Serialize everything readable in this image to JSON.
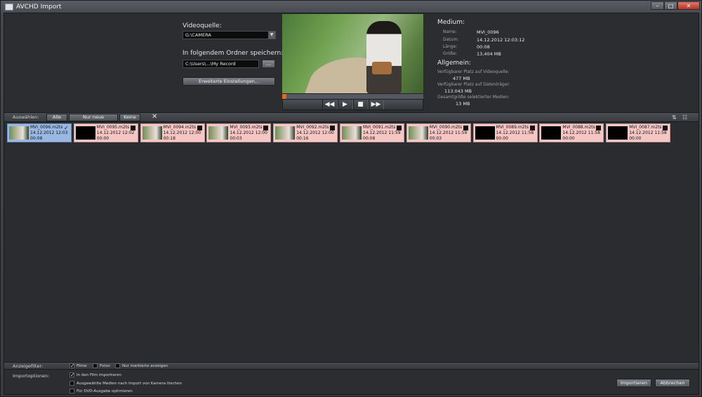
{
  "window": {
    "title": "AVCHD Import",
    "controls": {
      "minimize": "–",
      "maximize": "□",
      "close": "✕"
    }
  },
  "source": {
    "label": "Videoquelle:",
    "value": "G:\\CAMERA",
    "save_label": "In folgendem Ordner speichern:",
    "save_path": "C:\\Users\\...\\My Record",
    "folder_button": "…",
    "advanced_button": "Erweiterte Einstellungen..."
  },
  "player": {
    "progress_percent": 3,
    "buttons": {
      "rewind": "◀◀",
      "play": "▶",
      "stop": "■",
      "forward": "▶▶"
    }
  },
  "medium": {
    "title": "Medium:",
    "fields": [
      {
        "key": "Name:",
        "value": "MVI_0096"
      },
      {
        "key": "Datum:",
        "value": "14.12.2012 12:03:12"
      },
      {
        "key": "Länge:",
        "value": "00:08"
      },
      {
        "key": "Größe:",
        "value": "13,404 MB"
      }
    ]
  },
  "general": {
    "title": "Allgemein:",
    "items": [
      {
        "key": "Verfügbarer Platz auf Videoquelle:",
        "value": "477 MB"
      },
      {
        "key": "Verfügbarer Platz auf Datenträger:",
        "value": "113.043 MB"
      },
      {
        "key": "Gesamtgröße selektierter Medien:",
        "value": "13 MB"
      }
    ]
  },
  "selectbar": {
    "label": "Auswählen:",
    "all": "Alle",
    "new_only": "Nur neue",
    "none": "Keine",
    "clear": "✕",
    "sort_icon": "⇅",
    "view_icon": "☷"
  },
  "media": [
    {
      "name": "MVI_0096.m2ts",
      "date": "14.12.2012 12:03",
      "duration": "00:08",
      "selected": true,
      "thumb": "image"
    },
    {
      "name": "MVI_0095.m2ts",
      "date": "14.12.2012 12:02",
      "duration": "00:00",
      "selected": false,
      "thumb": "black"
    },
    {
      "name": "MVI_0094.m2ts",
      "date": "14.12.2012 12:00",
      "duration": "00:18",
      "selected": false,
      "thumb": "image"
    },
    {
      "name": "MVI_0093.m2ts",
      "date": "14.12.2012 12:00",
      "duration": "00:03",
      "selected": false,
      "thumb": "image"
    },
    {
      "name": "MVI_0092.m2ts",
      "date": "14.12.2012 12:00",
      "duration": "00:16",
      "selected": false,
      "thumb": "image"
    },
    {
      "name": "MVI_0091.m2ts",
      "date": "14.12.2012 11:59",
      "duration": "00:08",
      "selected": false,
      "thumb": "image"
    },
    {
      "name": "MVI_0090.m2ts",
      "date": "14.12.2012 11:59",
      "duration": "00:03",
      "selected": false,
      "thumb": "image"
    },
    {
      "name": "MVI_0089.m2ts",
      "date": "14.12.2012 11:58",
      "duration": "00:00",
      "selected": false,
      "thumb": "black"
    },
    {
      "name": "MVI_0088.m2ts",
      "date": "14.12.2012 11:58",
      "duration": "00:00",
      "selected": false,
      "thumb": "black"
    },
    {
      "name": "MVI_0087.m2ts",
      "date": "14.12.2012 11:58",
      "duration": "00:00",
      "selected": false,
      "thumb": "black"
    }
  ],
  "filter": {
    "label": "Anzeigefilter:",
    "films": "Filme",
    "photos": "Fotos",
    "marked_only": "Nur markierte anzeigen"
  },
  "import_options": {
    "label": "Importoptionen:",
    "into_film": "In den Film importieren",
    "delete_after": "Ausgewählte Medien nach Import von Kamera löschen",
    "dvd_optimize": "Für DVD-Ausgabe optimieren"
  },
  "buttons": {
    "import": "Importieren",
    "cancel": "Abbrechen"
  }
}
